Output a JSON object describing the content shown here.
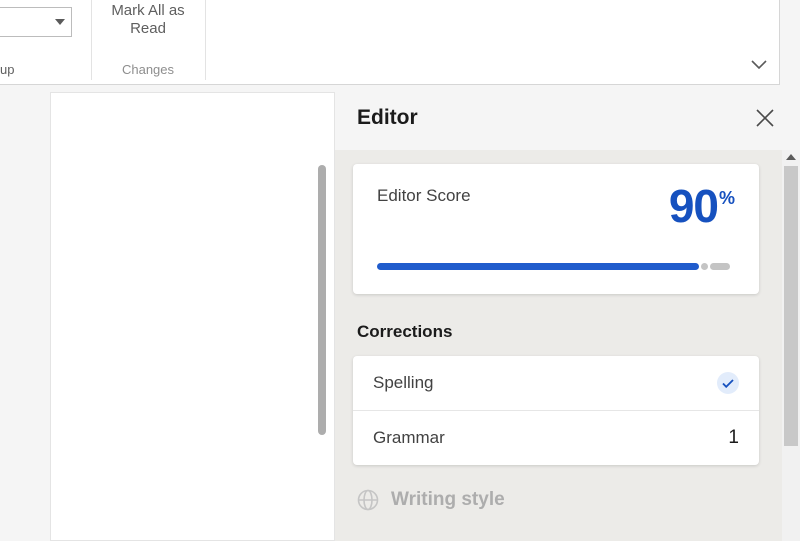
{
  "ribbon": {
    "up_group_label": "up",
    "mark_all_button": "Mark All as Read",
    "changes_group_label": "Changes"
  },
  "editor": {
    "title": "Editor",
    "score_label": "Editor Score",
    "score_value": "90",
    "score_unit": "%",
    "score_percent": 90,
    "corrections_label": "Corrections",
    "items": {
      "spelling": {
        "label": "Spelling",
        "status": "ok"
      },
      "grammar": {
        "label": "Grammar",
        "count": "1"
      }
    },
    "writing_style_hint": "Writing style"
  },
  "colors": {
    "accent": "#205ccc",
    "score_text": "#1651bf"
  }
}
